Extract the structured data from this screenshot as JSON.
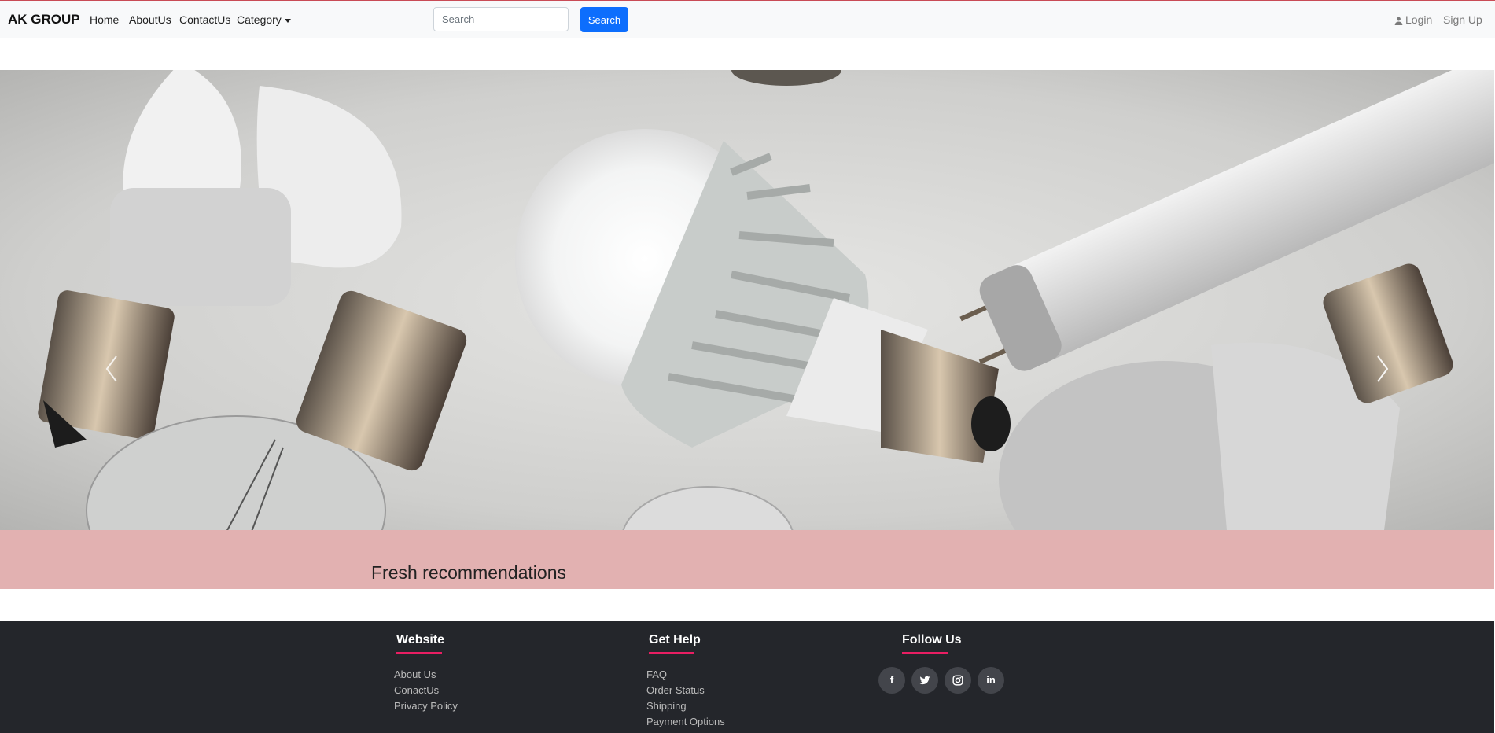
{
  "navbar": {
    "brand": "AK GROUP",
    "links": [
      "Home",
      "AboutUs",
      "ContactUs",
      "Category"
    ],
    "search": {
      "placeholder": "Search",
      "button_label": "Search"
    },
    "login_label": "Login",
    "signup_label": "Sign Up"
  },
  "hero": {
    "controls": [
      "chevron-left-icon",
      "chevron-right-icon"
    ]
  },
  "recommendations": {
    "title": "Fresh recommendations"
  },
  "footer": {
    "website": {
      "title": "Website",
      "links": [
        "About Us",
        "ConactUs",
        "Privacy Policy"
      ]
    },
    "get_help": {
      "title": "Get Help",
      "links": [
        "FAQ",
        "Order Status",
        "Shipping",
        "Payment Options"
      ]
    },
    "follow_us": {
      "title": "Follow Us",
      "icons": [
        "facebook-icon",
        "twitter-icon",
        "instagram-icon",
        "linkedin-icon"
      ],
      "linkedin_text": "in",
      "facebook_text": "f"
    }
  },
  "colors": {
    "accent": "#0d6efd",
    "recommendations_bg": "#e2b1b1",
    "footer_bg": "#24262b",
    "footer_underline": "#e91e63"
  }
}
